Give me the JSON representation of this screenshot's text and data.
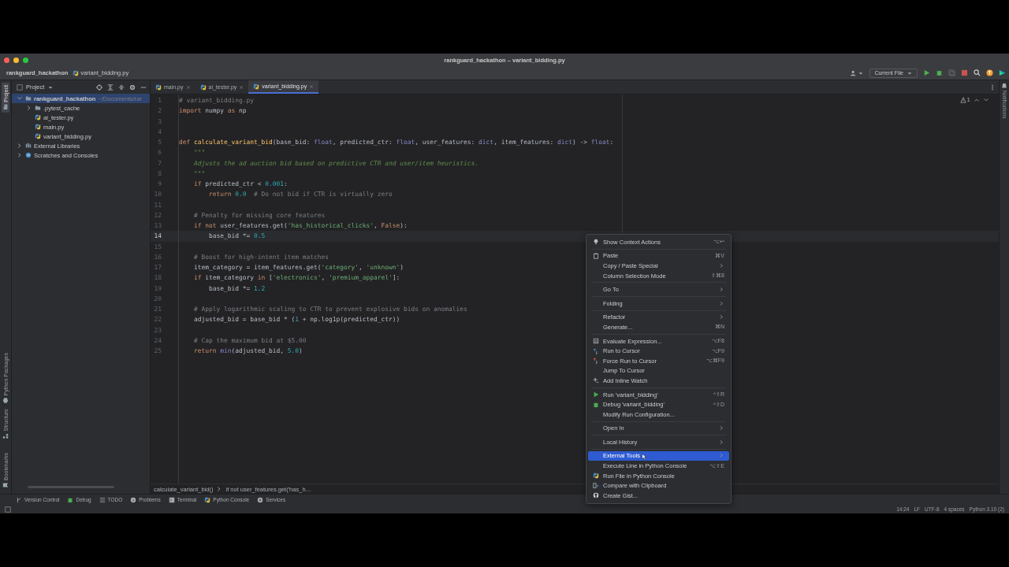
{
  "window": {
    "title": "rankguard_hackathon – variant_bidding.py"
  },
  "navbar": {
    "breadcrumb": [
      "rankguard_hackathon",
      "variant_bidding.py"
    ],
    "run_config": "Current File"
  },
  "left_strip": [
    {
      "label": "Project",
      "selected": true,
      "kind": "folder"
    },
    {
      "label": "Python Packages",
      "selected": false,
      "kind": "package"
    },
    {
      "label": "Structure",
      "selected": false,
      "kind": "structure"
    },
    {
      "label": "Bookmarks",
      "selected": false,
      "kind": "bookmark"
    }
  ],
  "right_strip": [
    {
      "label": "Notifications"
    }
  ],
  "project": {
    "title": "Project",
    "tree": [
      {
        "label": "rankguard_hackathon",
        "path": "~/Documents/rar",
        "kind": "project",
        "expanded": true,
        "selected": true,
        "children": [
          {
            "label": ".pytest_cache",
            "kind": "folder",
            "expanded": false,
            "selected": false
          },
          {
            "label": "ai_tester.py",
            "kind": "python",
            "selected": false
          },
          {
            "label": "main.py",
            "kind": "python",
            "selected": false
          },
          {
            "label": "variant_bidding.py",
            "kind": "python",
            "selected": false
          }
        ]
      },
      {
        "label": "External Libraries",
        "kind": "library",
        "expanded": false,
        "selected": false
      },
      {
        "label": "Scratches and Consoles",
        "kind": "scratch",
        "expanded": false,
        "selected": false
      }
    ]
  },
  "tabs": [
    {
      "label": "main.py",
      "selected": false
    },
    {
      "label": "ai_tester.py",
      "selected": false
    },
    {
      "label": "variant_bidding.py",
      "selected": true
    }
  ],
  "inspection": {
    "warnings": "1"
  },
  "editor": {
    "lines": [
      {
        "number": "1",
        "current": false,
        "tokens": [
          {
            "kind": "cmt",
            "text": "# variant_bidding.py"
          }
        ]
      },
      {
        "number": "2",
        "current": false,
        "tokens": [
          {
            "kind": "kw",
            "text": "import"
          },
          {
            "kind": "plain",
            "text": " numpy "
          },
          {
            "kind": "kw",
            "text": "as"
          },
          {
            "kind": "plain",
            "text": " np"
          }
        ]
      },
      {
        "number": "3",
        "current": false
      },
      {
        "number": "4",
        "current": false
      },
      {
        "number": "5",
        "current": false,
        "tokens": [
          {
            "kind": "kw",
            "text": "def "
          },
          {
            "kind": "fn",
            "text": "calculate_variant_bid"
          },
          {
            "kind": "plain",
            "text": "(base_bid: "
          },
          {
            "kind": "type",
            "text": "float"
          },
          {
            "kind": "plain",
            "text": ", predicted_ctr: "
          },
          {
            "kind": "type",
            "text": "float"
          },
          {
            "kind": "plain",
            "text": ", user_features: "
          },
          {
            "kind": "type",
            "text": "dict"
          },
          {
            "kind": "plain",
            "text": ", item_features: "
          },
          {
            "kind": "type",
            "text": "dict"
          },
          {
            "kind": "plain",
            "text": ") -> "
          },
          {
            "kind": "type",
            "text": "float"
          },
          {
            "kind": "plain",
            "text": ":"
          }
        ]
      },
      {
        "number": "6",
        "current": false,
        "tokens": [
          {
            "kind": "doc",
            "text": "    \"\"\""
          }
        ]
      },
      {
        "number": "7",
        "current": false,
        "tokens": [
          {
            "kind": "doc",
            "text": "    Adjusts the ad auction bid based on predictive CTR and user/item heuristics."
          }
        ]
      },
      {
        "number": "8",
        "current": false,
        "tokens": [
          {
            "kind": "doc",
            "text": "    \"\"\""
          }
        ]
      },
      {
        "number": "9",
        "current": false,
        "tokens": [
          {
            "kind": "kw",
            "text": "    if"
          },
          {
            "kind": "plain",
            "text": " predicted_ctr < "
          },
          {
            "kind": "num",
            "text": "0.001"
          },
          {
            "kind": "plain",
            "text": ":"
          }
        ]
      },
      {
        "number": "10",
        "current": false,
        "tokens": [
          {
            "kind": "kw",
            "text": "        return "
          },
          {
            "kind": "num",
            "text": "0.0"
          },
          {
            "kind": "cmt",
            "text": "  # Do not bid if CTR is virtually zero"
          }
        ]
      },
      {
        "number": "11",
        "current": false
      },
      {
        "number": "12",
        "current": false,
        "tokens": [
          {
            "kind": "cmt",
            "text": "    # Penalty for missing core features"
          }
        ]
      },
      {
        "number": "13",
        "current": false,
        "tokens": [
          {
            "kind": "kw",
            "text": "    if not"
          },
          {
            "kind": "plain",
            "text": " user_features.get("
          },
          {
            "kind": "str",
            "text": "'has_historical_clicks'"
          },
          {
            "kind": "plain",
            "text": ", "
          },
          {
            "kind": "kw",
            "text": "False"
          },
          {
            "kind": "plain",
            "text": "):"
          }
        ]
      },
      {
        "number": "14",
        "current": true,
        "tokens": [
          {
            "kind": "plain",
            "text": "        base_bid *= "
          },
          {
            "kind": "num",
            "text": "0.5"
          }
        ]
      },
      {
        "number": "15",
        "current": false
      },
      {
        "number": "16",
        "current": false,
        "tokens": [
          {
            "kind": "cmt",
            "text": "    # Boost for high-intent item matches"
          }
        ]
      },
      {
        "number": "17",
        "current": false,
        "tokens": [
          {
            "kind": "plain",
            "text": "    item_category = item_features.get("
          },
          {
            "kind": "str",
            "text": "'category'"
          },
          {
            "kind": "plain",
            "text": ", "
          },
          {
            "kind": "str",
            "text": "'unknown'"
          },
          {
            "kind": "plain",
            "text": ")"
          }
        ]
      },
      {
        "number": "18",
        "current": false,
        "tokens": [
          {
            "kind": "kw",
            "text": "    if"
          },
          {
            "kind": "plain",
            "text": " item_category "
          },
          {
            "kind": "kw",
            "text": "in"
          },
          {
            "kind": "plain",
            "text": " ["
          },
          {
            "kind": "str",
            "text": "'electronics'"
          },
          {
            "kind": "plain",
            "text": ", "
          },
          {
            "kind": "str",
            "text": "'premium_apparel'"
          },
          {
            "kind": "plain",
            "text": "]:"
          }
        ]
      },
      {
        "number": "19",
        "current": false,
        "tokens": [
          {
            "kind": "plain",
            "text": "        base_bid *= "
          },
          {
            "kind": "num",
            "text": "1.2"
          }
        ]
      },
      {
        "number": "20",
        "current": false
      },
      {
        "number": "21",
        "current": false,
        "tokens": [
          {
            "kind": "cmt",
            "text": "    # Apply logarithmic scaling to CTR to prevent explosive bids on anomalies"
          }
        ]
      },
      {
        "number": "22",
        "current": false,
        "tokens": [
          {
            "kind": "plain",
            "text": "    adjusted_bid = base_bid * ("
          },
          {
            "kind": "num",
            "text": "1"
          },
          {
            "kind": "plain",
            "text": " + np.log1p(predicted_ctr))"
          }
        ]
      },
      {
        "number": "23",
        "current": false
      },
      {
        "number": "24",
        "current": false,
        "tokens": [
          {
            "kind": "cmt",
            "text": "    # Cap the maximum bid at $5.00"
          }
        ]
      },
      {
        "number": "25",
        "current": false,
        "tokens": [
          {
            "kind": "kw",
            "text": "    return "
          },
          {
            "kind": "builtin",
            "text": "min"
          },
          {
            "kind": "plain",
            "text": "(adjusted_bid, "
          },
          {
            "kind": "num",
            "text": "5.0"
          },
          {
            "kind": "plain",
            "text": ")"
          }
        ]
      }
    ],
    "breadcrumb": [
      "calculate_variant_bid()",
      "if not user_features.get('has_h…"
    ]
  },
  "context_menu": {
    "groups": [
      [
        {
          "label": "Show Context Actions",
          "shortcut": "⌥↩",
          "kind": "bulb",
          "submenu": false,
          "selected": false
        }
      ],
      [
        {
          "label": "Paste",
          "shortcut": "⌘V",
          "kind": "clipboard",
          "submenu": false,
          "selected": false
        },
        {
          "label": "Copy / Paste Special",
          "kind": "plain",
          "submenu": true,
          "selected": false
        },
        {
          "label": "Column Selection Mode",
          "shortcut": "⇧⌘8",
          "kind": "plain",
          "submenu": false,
          "selected": false
        }
      ],
      [
        {
          "label": "Go To",
          "kind": "plain",
          "submenu": true,
          "selected": false
        }
      ],
      [
        {
          "label": "Folding",
          "kind": "plain",
          "submenu": true,
          "selected": false
        }
      ],
      [
        {
          "label": "Refactor",
          "kind": "plain",
          "submenu": true,
          "selected": false
        },
        {
          "label": "Generate...",
          "shortcut": "⌘N",
          "kind": "plain",
          "submenu": false,
          "selected": false
        }
      ],
      [
        {
          "label": "Evaluate Expression...",
          "shortcut": "⌥F8",
          "kind": "calculator",
          "submenu": false,
          "selected": false
        },
        {
          "label": "Run to Cursor",
          "shortcut": "⌥F9",
          "kind": "cursor",
          "submenu": false,
          "selected": false
        },
        {
          "label": "Force Run to Cursor",
          "shortcut": "⌥⌘F9",
          "kind": "force",
          "submenu": false,
          "selected": false
        },
        {
          "label": "Jump To Cursor",
          "kind": "plain",
          "submenu": false,
          "selected": false
        },
        {
          "label": "Add Inline Watch",
          "kind": "watch",
          "submenu": false,
          "selected": false
        }
      ],
      [
        {
          "label": "Run 'variant_bidding'",
          "shortcut": "^⇧R",
          "kind": "run",
          "submenu": false,
          "selected": false
        },
        {
          "label": "Debug 'variant_bidding'",
          "shortcut": "^⇧D",
          "kind": "debug",
          "submenu": false,
          "selected": false
        },
        {
          "label": "Modify Run Configuration...",
          "kind": "plain",
          "submenu": false,
          "selected": false
        }
      ],
      [
        {
          "label": "Open In",
          "kind": "plain",
          "submenu": true,
          "selected": false
        }
      ],
      [
        {
          "label": "Local History",
          "kind": "plain",
          "submenu": true,
          "selected": false
        }
      ],
      [
        {
          "label": "External Tools",
          "kind": "plain",
          "submenu": true,
          "selected": true
        },
        {
          "label": "Execute Line in Python Console",
          "shortcut": "⌥⇧E",
          "kind": "plain",
          "submenu": false,
          "selected": false
        },
        {
          "label": "Run File in Python Console",
          "kind": "python",
          "submenu": false,
          "selected": false
        },
        {
          "label": "Compare with Clipboard",
          "kind": "compare",
          "submenu": false,
          "selected": false
        },
        {
          "label": "Create Gist...",
          "kind": "gist",
          "submenu": false,
          "selected": false
        }
      ]
    ]
  },
  "tool_windows": [
    {
      "label": "Version Control",
      "kind": "branch"
    },
    {
      "label": "Debug",
      "kind": "debug"
    },
    {
      "label": "TODO",
      "kind": "list"
    },
    {
      "label": "Problems",
      "kind": "info"
    },
    {
      "label": "Terminal",
      "kind": "terminal"
    },
    {
      "label": "Python Console",
      "kind": "python"
    },
    {
      "label": "Services",
      "kind": "services"
    }
  ],
  "status_bar": {
    "items": [
      "14:24",
      "LF",
      "UTF-8",
      "4 spaces",
      "Python 3.10 (2)"
    ]
  }
}
